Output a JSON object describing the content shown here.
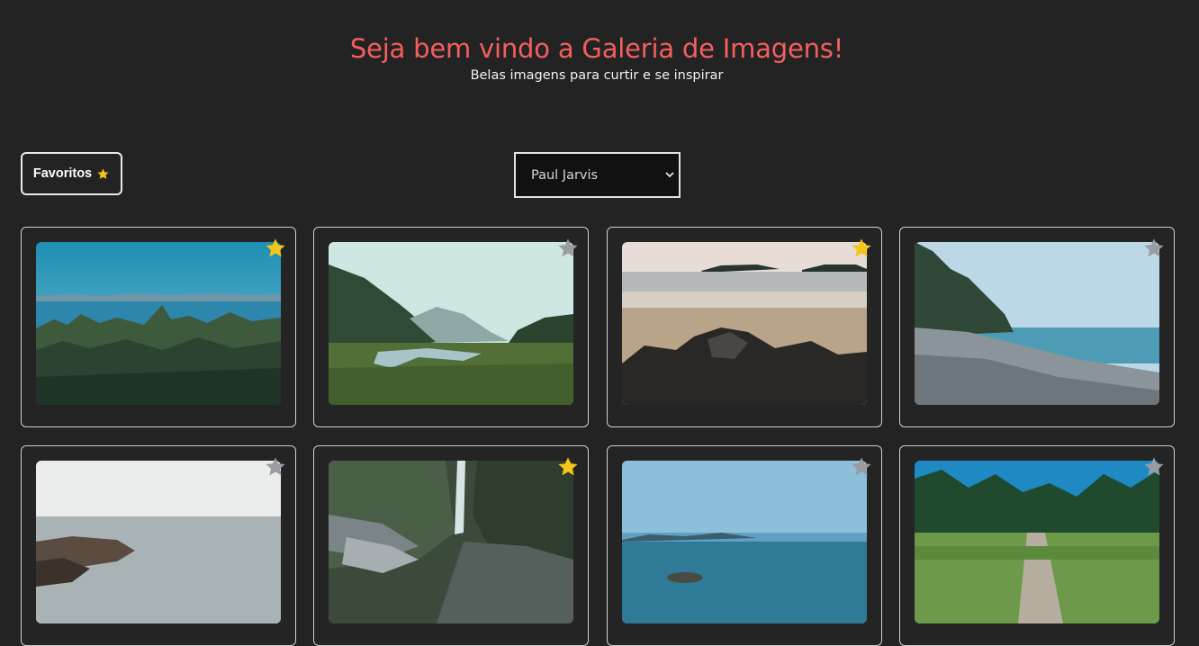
{
  "header": {
    "title": "Seja bem vindo a Galeria de Imagens!",
    "subtitle": "Belas imagens para curtir e se inspirar"
  },
  "toolbar": {
    "favorites_label": "Favoritos",
    "author_selected": "Paul Jarvis"
  },
  "colors": {
    "background": "#232323",
    "title": "#f45e5e",
    "star_active": "#f5c518",
    "star_inactive": "#9a9ba3"
  },
  "gallery": [
    {
      "favorite": true,
      "icon": "star-icon",
      "scene": "forest-lake"
    },
    {
      "favorite": false,
      "icon": "star-icon",
      "scene": "valley-river"
    },
    {
      "favorite": true,
      "icon": "star-icon",
      "scene": "beach-rocks"
    },
    {
      "favorite": false,
      "icon": "star-icon",
      "scene": "pebble-shore"
    },
    {
      "favorite": false,
      "icon": "star-icon",
      "scene": "misty-coast"
    },
    {
      "favorite": true,
      "icon": "star-icon",
      "scene": "waterfall-canyon"
    },
    {
      "favorite": false,
      "icon": "star-icon",
      "scene": "ocean-bay"
    },
    {
      "favorite": false,
      "icon": "star-icon",
      "scene": "forest-path"
    }
  ]
}
